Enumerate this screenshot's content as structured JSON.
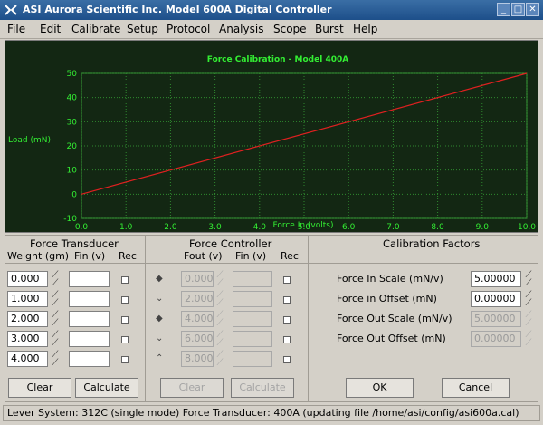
{
  "window": {
    "title": "ASI Aurora Scientific Inc.  Model 600A Digital Controller",
    "controls": [
      "minimize-icon",
      "maximize-icon",
      "close-icon"
    ]
  },
  "menu": [
    "File",
    "Edit",
    "Calibrate",
    "Setup",
    "Protocol",
    "Analysis",
    "Scope",
    "Burst",
    "Help"
  ],
  "chart_data": {
    "type": "line",
    "title": "Force Calibration  - Model 400A",
    "xlabel": "Force In (volts)",
    "ylabel": "Load (mN)",
    "xlim": [
      0,
      10
    ],
    "ylim": [
      -10,
      50
    ],
    "xticks": [
      "0.0",
      "1.0",
      "2.0",
      "3.0",
      "4.0",
      "5.0",
      "6.0",
      "7.0",
      "8.0",
      "9.0",
      "10.0"
    ],
    "yticks": [
      "50",
      "40",
      "30",
      "20",
      "10",
      "0",
      "-10"
    ],
    "grid": true,
    "series": [
      {
        "color": "#e02020",
        "x": [
          0,
          10
        ],
        "y": [
          0,
          50
        ]
      }
    ]
  },
  "force_transducer": {
    "header": "Force Transducer",
    "col_weight": "Weight (gm)",
    "col_fin": "Fin (v)",
    "col_rec": "Rec",
    "weights": [
      "0.000",
      "1.000",
      "2.000",
      "3.000",
      "4.000"
    ],
    "clear_label": "Clear",
    "calculate_label": "Calculate"
  },
  "force_controller": {
    "header": "Force Controller",
    "col_fout": "Fout (v)",
    "col_fin": "Fin (v)",
    "col_rec": "Rec",
    "fouts": [
      "0.000",
      "2.000",
      "4.000",
      "6.000",
      "8.000"
    ],
    "clear_label": "Clear",
    "calculate_label": "Calculate"
  },
  "calibration": {
    "header": "Calibration Factors",
    "rows": [
      {
        "label": "Force In Scale    (mN/v)",
        "value": "5.00000"
      },
      {
        "label": "Force in Offset      (mN)",
        "value": "0.00000"
      },
      {
        "label": "Force Out Scale  (mN/v)",
        "value": "5.00000"
      },
      {
        "label": "Force Out Offset (mN)",
        "value": "0.00000"
      }
    ],
    "ok_label": "OK",
    "cancel_label": "Cancel"
  },
  "status": "Lever System: 312C (single mode)  Force Transducer: 400A  (updating file /home/asi/config/asi600a.cal)"
}
